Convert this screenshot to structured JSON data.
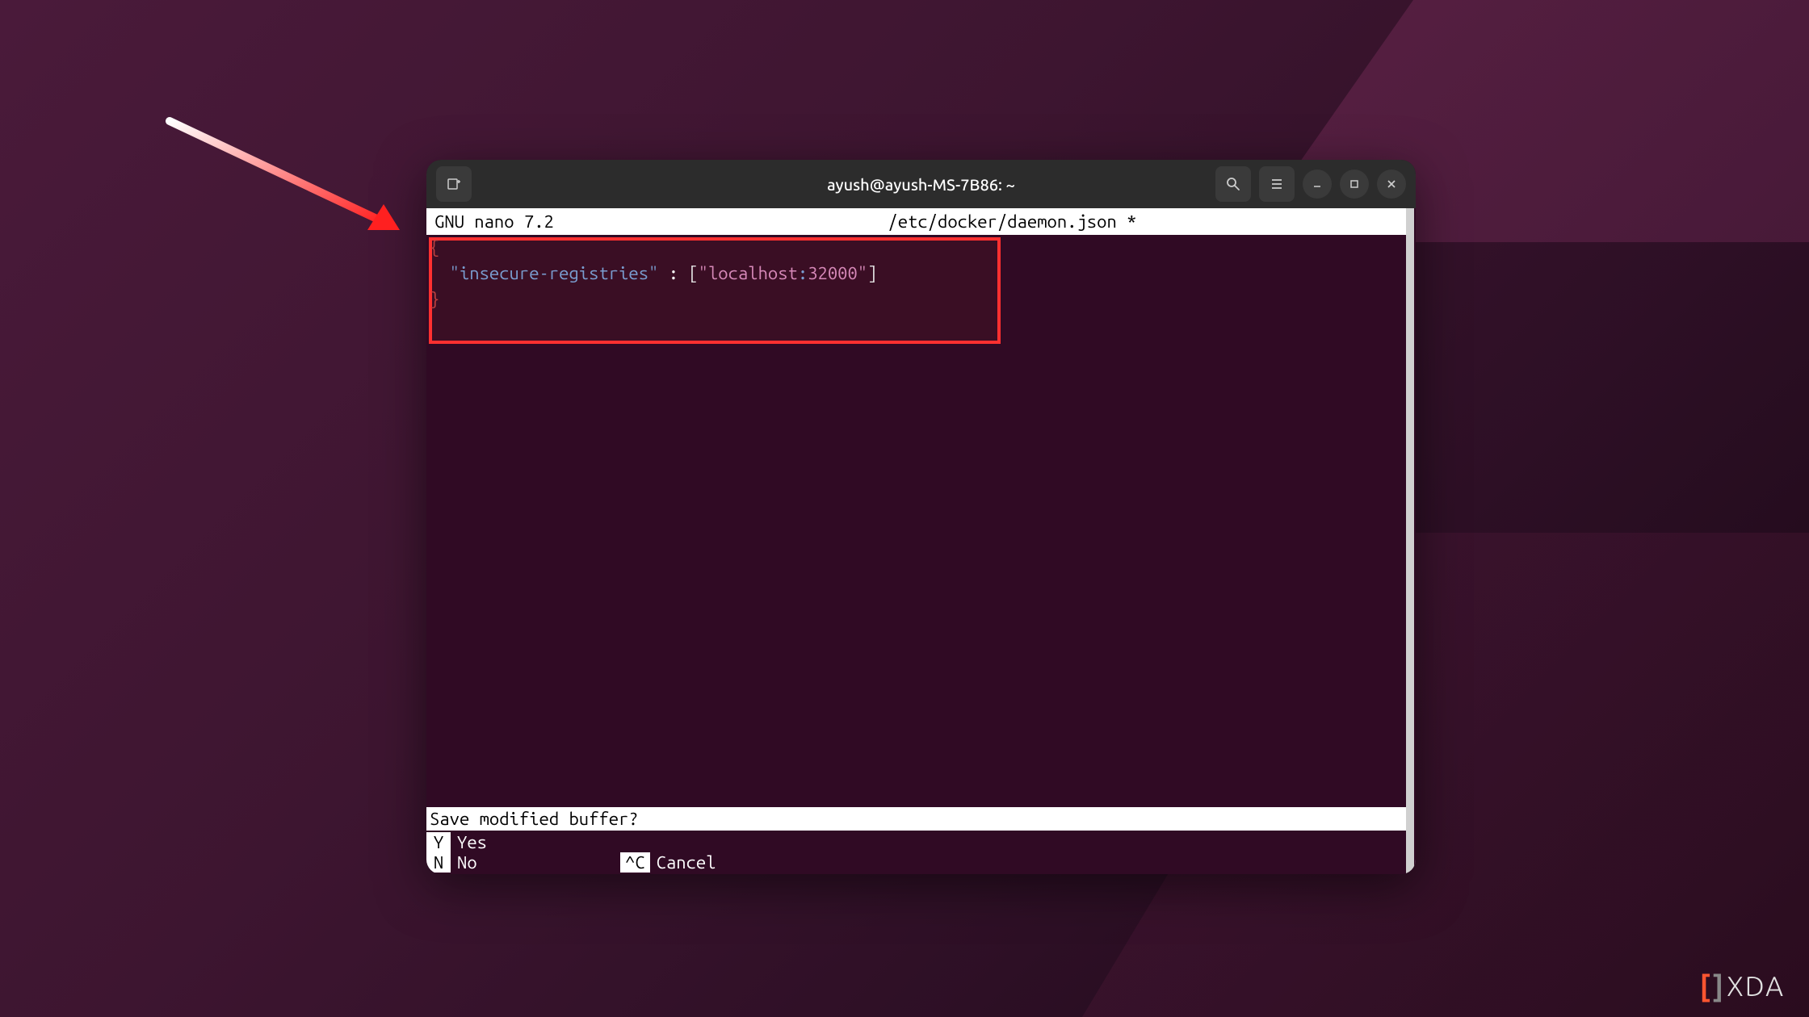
{
  "titlebar": {
    "title": "ayush@ayush-MS-7B86: ~"
  },
  "nano": {
    "app_name": "  GNU nano 7.2",
    "file_path": "/etc/docker/daemon.json *",
    "content": {
      "line1": "{",
      "key": "\"insecure-registries\"",
      "colon": " : ",
      "bracket_open": "[",
      "value_prefix": "\"localhost",
      "value_colon": ":",
      "value_port": "32000\"",
      "bracket_close": "]",
      "line3": "}"
    },
    "prompt": "Save modified buffer?",
    "options": {
      "yes_key": " Y",
      "yes_label": "Yes",
      "no_key": " N",
      "no_label": "No",
      "cancel_key": "^C",
      "cancel_label": "Cancel"
    }
  },
  "watermark": {
    "bracket_left": "[",
    "bracket_right": "]",
    "text": "XDA"
  }
}
